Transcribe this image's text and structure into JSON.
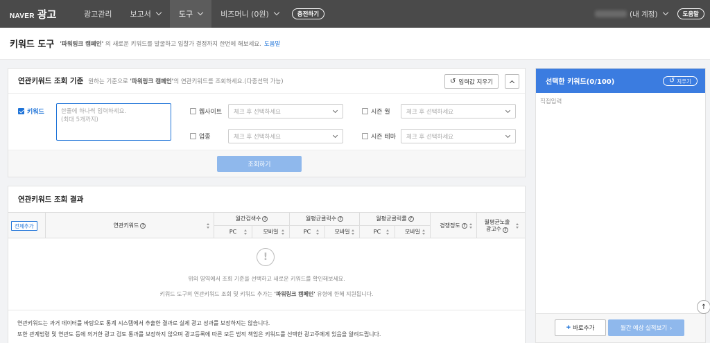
{
  "topnav": {
    "logo_naver": "NAVER",
    "logo_ad": "광고",
    "items": [
      {
        "label": "광고관리"
      },
      {
        "label": "보고서"
      },
      {
        "label": "도구"
      },
      {
        "label": "비즈머니 (0원)"
      }
    ],
    "charge_label": "충전하기",
    "account_label": "(내 계정)",
    "help_label": "도움말"
  },
  "subheader": {
    "title": "키워드 도구",
    "desc_campaign": "'파워링크 캠페인'",
    "desc_rest": " 의 새로운 키워드를 발굴하고 입찰가 결정까지 한번에 해보세요.",
    "help": "도움말"
  },
  "criteria": {
    "title": "연관키워드 조회 기준",
    "desc_prefix": "원하는 기준으로 ",
    "desc_campaign": "'파워링크 캠페인'",
    "desc_suffix": "의 연관키워드를 조회하세요.(다중선택 가능)",
    "clear_label": "입력값 지우기",
    "keyword_label": "키워드",
    "keyword_placeholder": "한줄에 하나씩 입력하세요.\n(최대 5개까지)",
    "website_label": "웹사이트",
    "industry_label": "업종",
    "season_month_label": "시즌 월",
    "season_theme_label": "시즌 테마",
    "select_placeholder": "체크 후 선택하세요",
    "search_label": "조회하기"
  },
  "results": {
    "title": "연관키워드 조회 결과",
    "add_all": "전체추가",
    "columns": {
      "keyword": "연관키워드",
      "monthly_search": "월간검색수",
      "monthly_clicks": "월평균클릭수",
      "monthly_ctr": "월평균클릭률",
      "competition": "경쟁정도",
      "ad_count_line1": "월평균노출",
      "ad_count_line2": "광고수",
      "pc": "PC",
      "mobile": "모바일"
    },
    "empty_icon": "!",
    "empty_line1": "위의 영역에서 조회 기준을 선택하고 새로운 키워드를 확인해보세요.",
    "empty_line2_prefix": "키워드 도구의 연관키워드 조회 및 키워드 추가는 ",
    "empty_line2_campaign": "'파워링크 캠페인'",
    "empty_line2_suffix": " 유형에 한해 지원됩니다.",
    "notice_line1": "연관키워드는 과거 데이터를 바탕으로 통계 시스템에서 추출한 결과로 실제 광고 성과를 보장하지는 않습니다.",
    "notice_line2": "또한 관계법령 및 연관도 등에 의거한 광고 검토 통과를 보장하지 않으며 광고등록에 따른 모든 법적 책임은 키워드를 선택한 광고주에게 있음을 알려드립니다."
  },
  "selected": {
    "title": "선택한 키워드(0/100)",
    "clear_label": "지우기",
    "direct_input": "직접입력",
    "add_now": "바로추가",
    "monthly_estimate": "월간 예상 실적보기"
  },
  "colors": {
    "nav_bg": "#4a4a4a",
    "accent": "#1e73d8",
    "selected_head": "#3b7ce0",
    "disabled_button": "#8fb8ec"
  }
}
